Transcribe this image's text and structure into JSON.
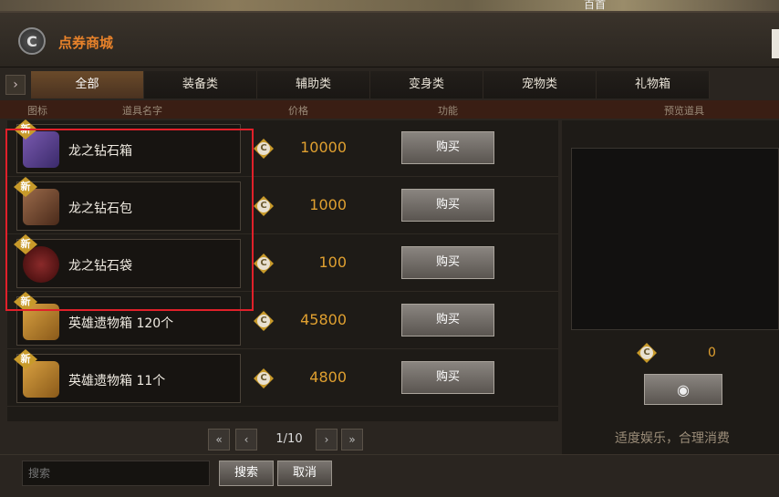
{
  "top_strip_text": "百首",
  "title": "点券商城",
  "tabs": [
    "全部",
    "装备类",
    "辅助类",
    "变身类",
    "宠物类",
    "礼物箱"
  ],
  "column_headers": {
    "icon": "图标",
    "name": "道具名字",
    "price": "价格",
    "function": "功能",
    "preview": "预览道具"
  },
  "new_badge": "新",
  "buy_label": "购买",
  "items": [
    {
      "name": "龙之钻石箱",
      "price": "10000",
      "icon": "purple-treasure-chest-icon"
    },
    {
      "name": "龙之钻石包",
      "price": "1000",
      "icon": "brown-treasure-chest-icon"
    },
    {
      "name": "龙之钻石袋",
      "price": "100",
      "icon": "red-pouch-icon"
    },
    {
      "name": "英雄遗物箱 120个",
      "price": "45800",
      "icon": "golden-chest-icon"
    },
    {
      "name": "英雄遗物箱 11个",
      "price": "4800",
      "icon": "golden-chest-icon"
    }
  ],
  "pager": {
    "text": "1/10"
  },
  "preview": {
    "total": "0",
    "slogan": "适度娱乐，合理消费"
  },
  "search": {
    "placeholder": "搜索",
    "search_label": "搜索",
    "cancel_label": "取消"
  },
  "colors": {
    "accent": "#e8822a",
    "price": "#e0a030",
    "highlight": "#e0202a"
  }
}
